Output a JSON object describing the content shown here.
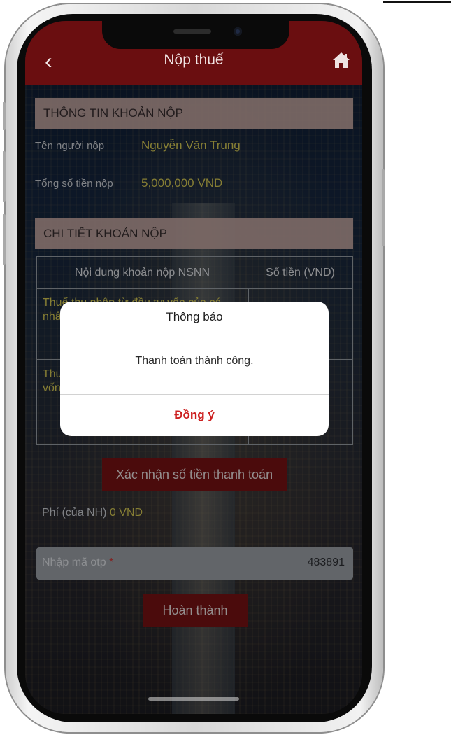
{
  "header": {
    "title": "Nộp thuế"
  },
  "section_info": {
    "title": "THÔNG TIN KHOẢN NỘP",
    "payer_label": "Tên người nộp",
    "payer_value": "Nguyễn Văn Trung",
    "total_label": "Tổng số tiền nộp",
    "total_value": "5,000,000 VND"
  },
  "section_detail": {
    "title": "CHI TIẾT KHOẢN NỘP",
    "columns": [
      "Nội dung khoản nộp NSNN",
      "Số tiền (VND)"
    ],
    "rows": [
      {
        "content_line1": "Thuế thu nhập từ đầu tư vốn của cá",
        "content_line2": "nhân"
      },
      {
        "content_line1": "Thu",
        "content_line2": "vốn"
      }
    ]
  },
  "confirm_button": "Xác nhận số tiền thanh toán",
  "fee": {
    "label": "Phí (của NH)",
    "value": "0 VND"
  },
  "otp": {
    "placeholder": "Nhập mã otp",
    "required_mark": "*",
    "value": "483891"
  },
  "done_button": "Hoàn thành",
  "dialog": {
    "title": "Thông báo",
    "message": "Thanh toán thành công.",
    "ok_button": "Đồng ý"
  },
  "colors": {
    "header_bg": "#6a0e10",
    "button_bg": "#7a1214",
    "value_text": "#d8cc54",
    "dialog_ok": "#cc1f1f"
  },
  "icons": [
    "back-icon",
    "home-icon"
  ]
}
